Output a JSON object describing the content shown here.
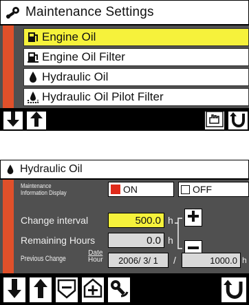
{
  "screen1": {
    "title": "Maintenance Settings",
    "title_icon": "wrench-gear-icon",
    "items": [
      {
        "label": "Engine Oil",
        "icon": "fuel-pump-icon",
        "selected": true
      },
      {
        "label": "Engine Oil Filter",
        "icon": "filter-icon",
        "selected": false
      },
      {
        "label": "Hydraulic Oil",
        "icon": "oil-drop-icon",
        "selected": false
      },
      {
        "label": "Hydraulic Oil Pilot Filter",
        "icon": "drop-filter-icon",
        "selected": false
      }
    ],
    "buttons": [
      "arrow-down-icon",
      "arrow-up-icon",
      "select-hand-icon",
      "return-icon"
    ]
  },
  "screen2": {
    "title": "Hydraulic Oil",
    "title_icon": "oil-drop-icon",
    "display_label_line1": "Maintenance",
    "display_label_line2": "Information Display",
    "on_label": "ON",
    "off_label": "OFF",
    "change_interval_label": "Change interval",
    "change_interval_value": "500.0",
    "unit_h": "h",
    "remaining_label": "Remaining Hours",
    "remaining_value": "0.0",
    "previous_change_label": "Previous Change",
    "date_label": "Date",
    "hour_label": "Hour",
    "previous_date": "2006/ 3/ 1",
    "slash": "/",
    "previous_hours": "1000.0",
    "buttons": [
      "arrow-down-icon",
      "arrow-up-icon",
      "minus-box-icon",
      "plus-box-icon",
      "reset-wrench-icon",
      "return-icon"
    ]
  },
  "colors": {
    "selected_highlight": "#f6f23b",
    "sidebar_accent": "#e0502a",
    "panel_bg": "#505050",
    "on_indicator": "#e02a1a"
  }
}
